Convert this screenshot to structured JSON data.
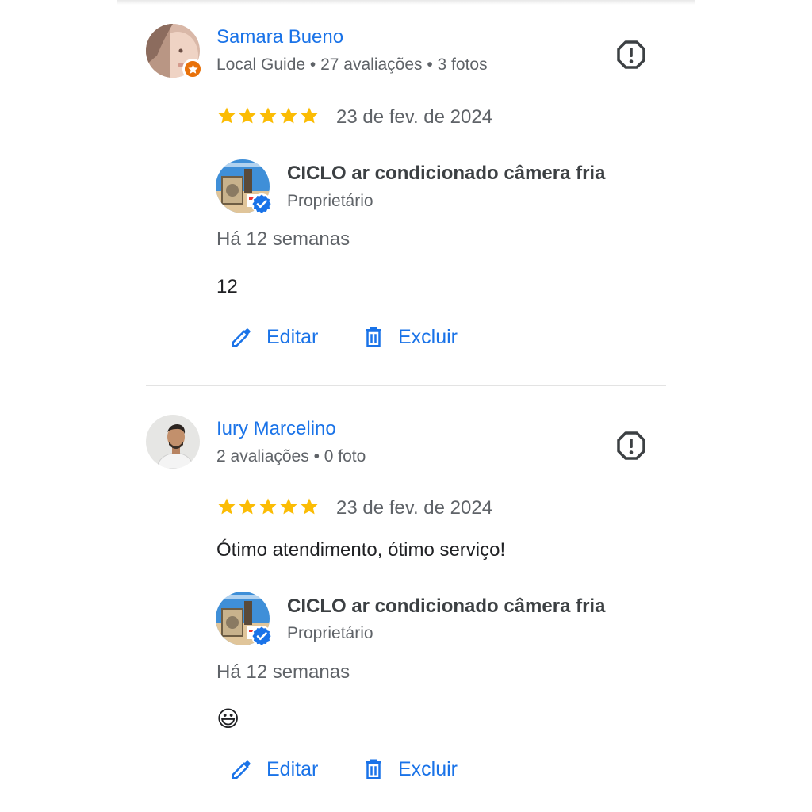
{
  "reviews": [
    {
      "author": "Samara Bueno",
      "meta": "Local Guide • 27 avaliações • 3 fotos",
      "rating": 5,
      "date": "23 de fev. de 2024",
      "text": "",
      "reply": {
        "owner": "CICLO ar condicionado câmera fria",
        "role": "Proprietário",
        "time": "Há 12 semanas",
        "text": "12"
      },
      "actions": {
        "edit": "Editar",
        "delete": "Excluir"
      }
    },
    {
      "author": "Iury Marcelino",
      "meta": "2 avaliações • 0 foto",
      "rating": 5,
      "date": "23 de fev. de 2024",
      "text": "Ótimo atendimento, ótimo serviço!",
      "reply": {
        "owner": "CICLO ar condicionado câmera fria",
        "role": "Proprietário",
        "time": "Há 12 semanas",
        "text": "😃"
      },
      "actions": {
        "edit": "Editar",
        "delete": "Excluir"
      }
    }
  ],
  "colors": {
    "accent": "#1a73e8",
    "star": "#fbbc04",
    "local_guide_badge": "#e8710a",
    "secondary_text": "#5f6368"
  },
  "icons": {
    "report": "report-octagon-icon",
    "star": "star-icon",
    "edit": "pencil-icon",
    "delete": "trash-icon",
    "verified": "verified-check-icon",
    "local_guide": "local-guide-star-icon"
  }
}
